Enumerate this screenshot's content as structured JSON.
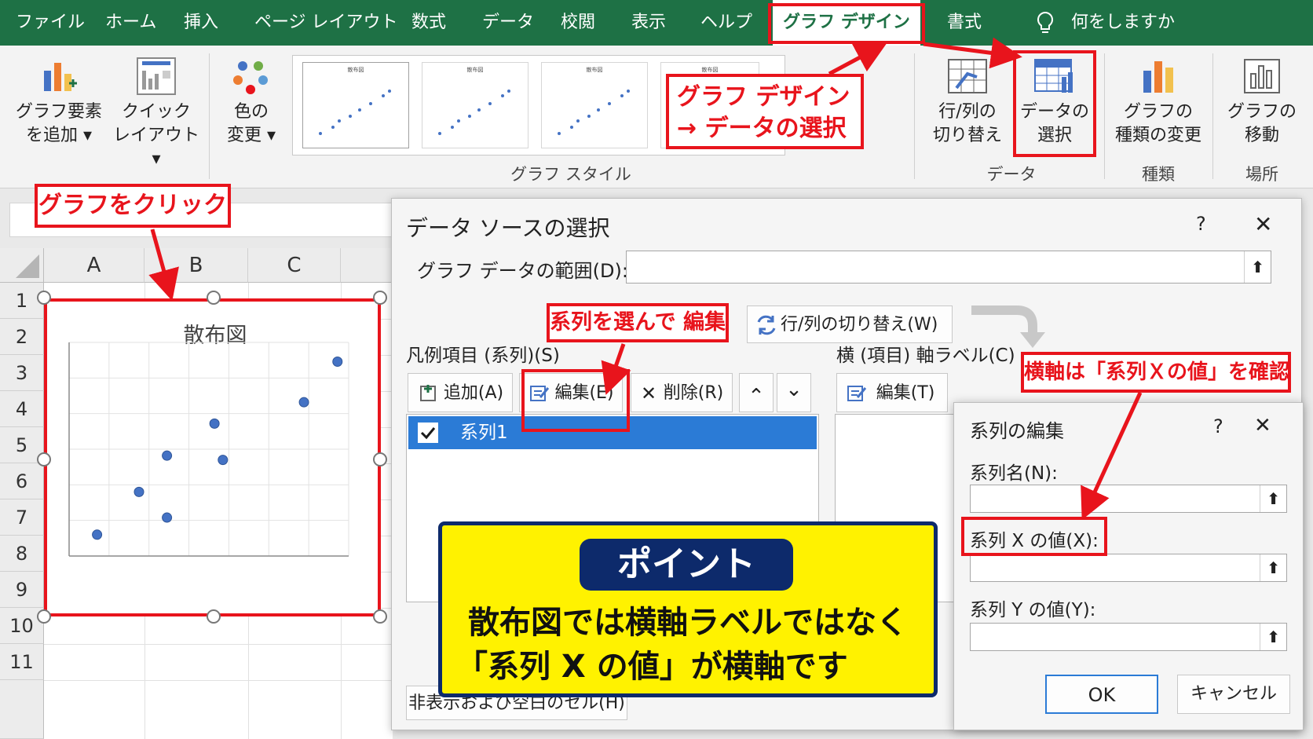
{
  "menubar": {
    "items": [
      "ファイル",
      "ホーム",
      "挿入",
      "ページ レイアウト",
      "数式",
      "データ",
      "校閲",
      "表示",
      "ヘルプ"
    ],
    "active_tab": "グラフ デザイン",
    "format_tab": "書式",
    "search_hint": "何をしますか",
    "bg_color": "#1e7145"
  },
  "ribbon": {
    "add_element": [
      "グラフ要素",
      "を追加 ▾"
    ],
    "quick_layout": [
      "クイック",
      "レイアウト ▾"
    ],
    "change_colors": [
      "色の",
      "変更 ▾"
    ],
    "style_thumb_title": "散布図",
    "styles_label": "グラフ スタイル",
    "switch_row_col": [
      "行/列の",
      "切り替え"
    ],
    "select_data": [
      "データの",
      "選択"
    ],
    "data_label": "データ",
    "change_type": [
      "グラフの",
      "種類の変更"
    ],
    "type_label": "種類",
    "move_chart": [
      "グラフの",
      "移動"
    ],
    "location_label": "場所"
  },
  "callouts": {
    "design_select": [
      "グラフ デザイン",
      "→ データの選択"
    ],
    "click_chart": "グラフをクリック",
    "select_series_edit": "系列を選んで 編集",
    "check_x_axis": "横軸は「系列Ｘの値」を確認",
    "accent_color": "#e8141c"
  },
  "sheet": {
    "columns": [
      "A",
      "B",
      "C"
    ],
    "rows": [
      "1",
      "2",
      "3",
      "4",
      "5",
      "6",
      "7",
      "8",
      "9",
      "10",
      "11"
    ]
  },
  "chart_data": {
    "type": "scatter",
    "title": "散布図",
    "x": [
      1,
      2.5,
      3.5,
      3.5,
      5.2,
      5.5,
      8.4,
      9.6
    ],
    "y": [
      1.0,
      3.0,
      1.8,
      4.7,
      6.2,
      4.5,
      7.2,
      9.1
    ],
    "xlim": [
      0,
      10
    ],
    "ylim": [
      0,
      10
    ],
    "grid": true,
    "marker_color": "#4472c4"
  },
  "dialog_main": {
    "title": "データ ソースの選択",
    "help": "?",
    "close": "✕",
    "range_label": "グラフ データの範囲(D):",
    "range_value": "",
    "switch_button": "行/列の切り替え(W)",
    "legend_label": "凡例項目 (系列)(S)",
    "add_button": "追加(A)",
    "edit_button": "編集(E)",
    "delete_button": "削除(R)",
    "up_button": "⌃",
    "down_button": "⌄",
    "series_items": [
      "系列1"
    ],
    "axis_label": "横 (項目) 軸ラベル(C)",
    "axis_edit_button": "編集(T)",
    "hidden_cells_button": "非表示および空白のセル(H)"
  },
  "dialog_edit": {
    "title": "系列の編集",
    "help": "?",
    "close": "✕",
    "name_label": "系列名(N):",
    "x_label": "系列 X の値(X):",
    "y_label": "系列 Y の値(Y):",
    "ok_button": "OK",
    "cancel_button": "キャンセル"
  },
  "point": {
    "badge": "ポイント",
    "lines": [
      "散布図では横軸ラベルではなく",
      "「系列 X の値」が横軸です"
    ],
    "box_color": "#fff200",
    "border_color": "#0d2a6b"
  }
}
